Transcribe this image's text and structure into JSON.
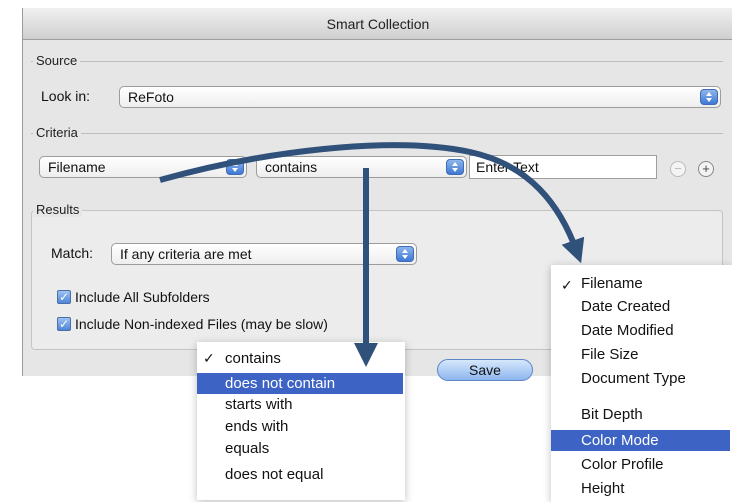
{
  "dialog": {
    "title": "Smart Collection",
    "source": {
      "label": "Source",
      "look_in_label": "Look in:",
      "look_in_value": "ReFoto"
    },
    "criteria": {
      "label": "Criteria",
      "field_value": "Filename",
      "operator_value": "contains",
      "text_placeholder": "Enter Text",
      "remove_glyph": "−",
      "add_glyph": "+"
    },
    "results": {
      "label": "Results",
      "match_label": "Match:",
      "match_value": "If any criteria are met",
      "checkbox_subfolders": "Include All Subfolders",
      "checkbox_nonindexed": "Include Non-indexed Files (may be slow)",
      "checkmark": "✓"
    },
    "save_label": "Save"
  },
  "operator_menu": {
    "checkmark": "✓",
    "items": [
      "contains",
      "does not contain",
      "starts with",
      "ends with",
      "equals",
      "does not equal"
    ],
    "checked_index": 0,
    "highlighted_index": 1
  },
  "field_menu": {
    "checkmark": "✓",
    "items": [
      "Filename",
      "Date Created",
      "Date Modified",
      "File Size",
      "Document Type",
      "Bit Depth",
      "Color Mode",
      "Color Profile",
      "Height"
    ],
    "checked_index": 0,
    "highlighted_index": 6
  },
  "colors": {
    "highlight": "#3d63c4",
    "arrow": "#30517a",
    "stepper": "#3f78d4"
  }
}
